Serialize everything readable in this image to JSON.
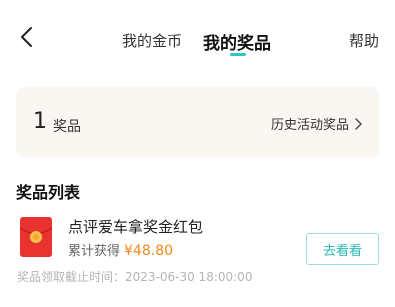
{
  "nav": {
    "tabs": [
      {
        "label": "我的金币",
        "active": false
      },
      {
        "label": "我的奖品",
        "active": true
      }
    ],
    "help_label": "帮助",
    "accent_color": "#2cc7c4"
  },
  "summary": {
    "count": "1",
    "unit": "奖品",
    "history_label": "历史活动奖品"
  },
  "list": {
    "title": "奖品列表",
    "items": [
      {
        "name": "点评爱车拿奖金红包",
        "earned_label": "累计获得",
        "amount": "¥48.80",
        "action_label": "去看看",
        "deadline": "奖品领取截止时间：2023-06-30 18:00:00",
        "icon": "red-envelope-icon"
      }
    ]
  }
}
